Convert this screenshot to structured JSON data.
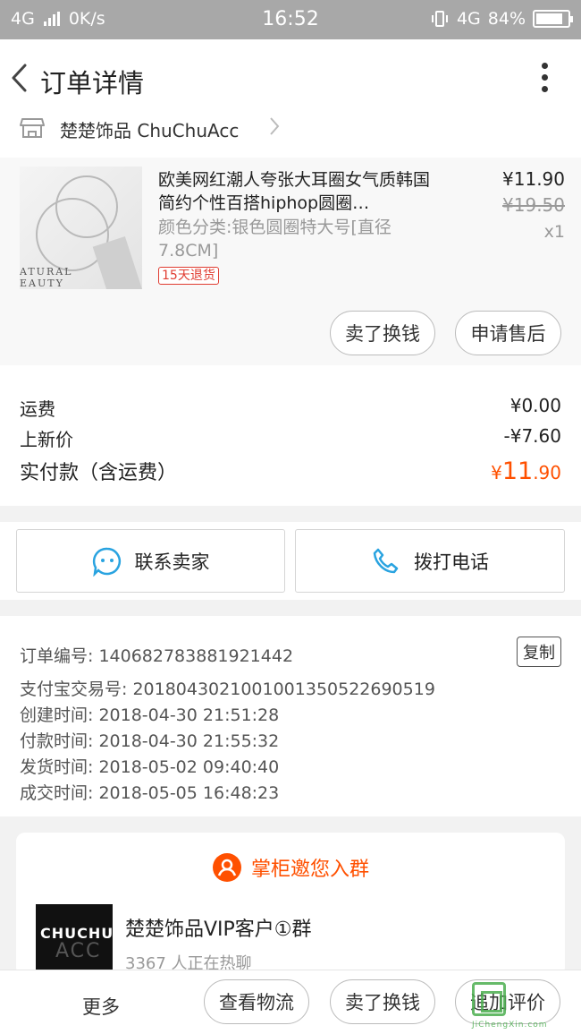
{
  "status_bar": {
    "network": "4G",
    "speed": "0K/s",
    "time": "16:52",
    "right_network": "4G",
    "battery": "84%",
    "battery_level": 0.84
  },
  "header": {
    "title": "订单详情"
  },
  "shop": {
    "name": "楚楚饰品 ChuChuAcc"
  },
  "product": {
    "title": "欧美网红潮人夸张大耳圈女气质韩国简约个性百搭hiphop圆圈…",
    "sku": "颜色分类:银色圆圈特大号[直径7.8CM]",
    "return_tag": "15天退货",
    "price": "¥11.90",
    "original_price": "¥19.50",
    "quantity": "x1",
    "image_text": "ATURAL\nEAUTY"
  },
  "item_actions": {
    "sell_exchange": "卖了换钱",
    "after_sales": "申请售后"
  },
  "fees": {
    "shipping_label": "运费",
    "shipping_value": "¥0.00",
    "new_price_label": "上新价",
    "new_price_value": "-¥7.60",
    "total_label": "实付款（含运费）",
    "total_symbol": "¥",
    "total_int": "11",
    "total_dec": ".90"
  },
  "contact": {
    "seller": "联系卖家",
    "phone": "拨打电话"
  },
  "order_info": {
    "order_no": "订单编号: 140682783881921442",
    "copy": "复制",
    "alipay_no": "支付宝交易号: 2018043021001001350522690519",
    "created": "创建时间: 2018-04-30 21:51:28",
    "paid": "付款时间: 2018-04-30 21:55:32",
    "shipped": "发货时间: 2018-05-02 09:40:40",
    "completed": "成交时间: 2018-05-05 16:48:23"
  },
  "group": {
    "invite": "掌柜邀您入群",
    "logo_text": "CHUCHU",
    "logo_sub": "ACC",
    "name": "楚楚饰品VIP客户①群",
    "count": "3367 人正在热聊"
  },
  "bottom_bar": {
    "more": "更多",
    "logistics": "查看物流",
    "sell_exchange": "卖了换钱",
    "review": "追加评价"
  },
  "watermark": {
    "site": "JiChengXin.com"
  },
  "colors": {
    "accent": "#ff5000",
    "tag_red": "#e03c31",
    "icon_blue": "#29a3e0",
    "statusbar": "#a8a8a8"
  }
}
